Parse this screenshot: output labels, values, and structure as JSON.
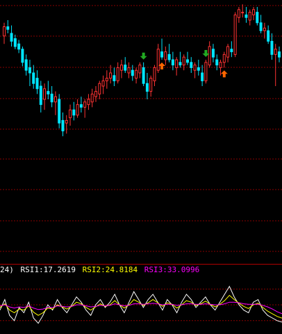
{
  "chart_data": [
    {
      "type": "candlestick",
      "title": "",
      "colors": {
        "up": "#ff3333",
        "down": "#00e5ff",
        "grid": "#8a0000",
        "background": "#000000"
      },
      "grid": true,
      "price_range": [
        0,
        100
      ],
      "candles": [
        [
          78,
          88,
          72,
          85
        ],
        [
          85,
          90,
          80,
          83
        ],
        [
          80,
          86,
          70,
          74
        ],
        [
          76,
          79,
          68,
          70
        ],
        [
          72,
          75,
          65,
          68
        ],
        [
          68,
          70,
          55,
          58
        ],
        [
          60,
          64,
          48,
          52
        ],
        [
          54,
          60,
          40,
          50
        ],
        [
          50,
          56,
          38,
          42
        ],
        [
          46,
          52,
          34,
          38
        ],
        [
          40,
          44,
          20,
          26
        ],
        [
          30,
          42,
          22,
          38
        ],
        [
          36,
          44,
          30,
          34
        ],
        [
          34,
          40,
          24,
          28
        ],
        [
          28,
          36,
          18,
          32
        ],
        [
          30,
          34,
          8,
          12
        ],
        [
          14,
          20,
          2,
          6
        ],
        [
          12,
          18,
          4,
          14
        ],
        [
          16,
          26,
          10,
          22
        ],
        [
          22,
          28,
          14,
          18
        ],
        [
          18,
          30,
          16,
          26
        ],
        [
          26,
          32,
          20,
          24
        ],
        [
          24,
          30,
          16,
          28
        ],
        [
          26,
          34,
          22,
          30
        ],
        [
          28,
          38,
          24,
          34
        ],
        [
          32,
          40,
          28,
          36
        ],
        [
          34,
          44,
          30,
          42
        ],
        [
          40,
          48,
          34,
          44
        ],
        [
          44,
          52,
          38,
          46
        ],
        [
          46,
          56,
          42,
          50
        ],
        [
          48,
          54,
          40,
          44
        ],
        [
          44,
          58,
          42,
          54
        ],
        [
          52,
          60,
          46,
          56
        ],
        [
          56,
          62,
          50,
          52
        ],
        [
          50,
          58,
          46,
          54
        ],
        [
          52,
          56,
          44,
          48
        ],
        [
          46,
          54,
          42,
          52
        ],
        [
          50,
          58,
          46,
          56
        ],
        [
          54,
          58,
          40,
          42
        ],
        [
          42,
          50,
          30,
          36
        ],
        [
          36,
          48,
          32,
          46
        ],
        [
          44,
          56,
          40,
          54
        ],
        [
          52,
          72,
          50,
          68
        ],
        [
          66,
          76,
          60,
          62
        ],
        [
          60,
          70,
          56,
          66
        ],
        [
          64,
          72,
          58,
          60
        ],
        [
          60,
          66,
          52,
          56
        ],
        [
          54,
          62,
          48,
          60
        ],
        [
          58,
          66,
          54,
          56
        ],
        [
          56,
          64,
          52,
          62
        ],
        [
          60,
          66,
          56,
          58
        ],
        [
          58,
          62,
          50,
          54
        ],
        [
          52,
          58,
          46,
          56
        ],
        [
          54,
          60,
          48,
          52
        ],
        [
          50,
          56,
          40,
          44
        ],
        [
          44,
          60,
          42,
          58
        ],
        [
          56,
          74,
          54,
          70
        ],
        [
          68,
          72,
          58,
          62
        ],
        [
          60,
          64,
          52,
          56
        ],
        [
          54,
          60,
          48,
          58
        ],
        [
          58,
          66,
          54,
          64
        ],
        [
          62,
          72,
          58,
          70
        ],
        [
          68,
          74,
          62,
          66
        ],
        [
          64,
          96,
          62,
          94
        ],
        [
          92,
          100,
          88,
          98
        ],
        [
          96,
          102,
          92,
          96
        ],
        [
          94,
          100,
          88,
          92
        ],
        [
          90,
          98,
          86,
          96
        ],
        [
          94,
          100,
          90,
          98
        ],
        [
          96,
          100,
          86,
          88
        ],
        [
          88,
          94,
          80,
          82
        ],
        [
          82,
          88,
          76,
          84
        ],
        [
          82,
          86,
          72,
          74
        ],
        [
          74,
          80,
          60,
          64
        ],
        [
          64,
          72,
          40,
          68
        ],
        [
          66,
          70,
          58,
          62
        ]
      ],
      "markers": [
        {
          "candle": 38,
          "direction": "down",
          "color": "#22aa22"
        },
        {
          "candle": 43,
          "direction": "up",
          "color": "#ff6600"
        },
        {
          "candle": 55,
          "direction": "down",
          "color": "#22aa22"
        },
        {
          "candle": 60,
          "direction": "up",
          "color": "#ff6600"
        }
      ]
    },
    {
      "type": "line",
      "title": "",
      "header_prefix": "24)",
      "ylim": [
        0,
        100
      ],
      "grid": true,
      "series": [
        {
          "name": "RSI1",
          "label": "RSI1:17.2619",
          "color": "#ffffff",
          "values": [
            40,
            60,
            30,
            20,
            45,
            35,
            55,
            25,
            15,
            30,
            50,
            40,
            60,
            45,
            35,
            50,
            65,
            55,
            40,
            30,
            50,
            60,
            45,
            55,
            70,
            50,
            35,
            55,
            75,
            60,
            45,
            60,
            70,
            55,
            40,
            60,
            50,
            35,
            55,
            70,
            60,
            45,
            55,
            65,
            50,
            40,
            55,
            70,
            85,
            65,
            50,
            40,
            35,
            55,
            60,
            40,
            30,
            25,
            20,
            17.2619
          ]
        },
        {
          "name": "RSI2",
          "label": "RSI2:24.8184",
          "color": "#ffff00",
          "values": [
            45,
            52,
            40,
            35,
            42,
            40,
            48,
            36,
            30,
            35,
            44,
            42,
            50,
            46,
            42,
            47,
            55,
            52,
            45,
            40,
            46,
            52,
            47,
            50,
            58,
            50,
            44,
            50,
            60,
            55,
            49,
            54,
            60,
            54,
            47,
            54,
            51,
            44,
            50,
            58,
            55,
            49,
            52,
            57,
            51,
            46,
            51,
            58,
            68,
            60,
            53,
            47,
            43,
            50,
            53,
            45,
            38,
            33,
            28,
            24.8184
          ]
        },
        {
          "name": "RSI3",
          "label": "RSI3:33.0996",
          "color": "#ff00ff",
          "values": [
            48,
            50,
            46,
            44,
            46,
            45,
            48,
            44,
            41,
            42,
            45,
            45,
            48,
            47,
            46,
            47,
            50,
            50,
            48,
            46,
            47,
            49,
            48,
            49,
            52,
            50,
            48,
            49,
            52,
            52,
            51,
            52,
            53,
            52,
            50,
            51,
            51,
            49,
            50,
            52,
            52,
            51,
            51,
            52,
            51,
            50,
            50,
            52,
            55,
            55,
            54,
            52,
            51,
            51,
            51,
            49,
            46,
            42,
            37,
            33.0996
          ]
        }
      ]
    }
  ]
}
